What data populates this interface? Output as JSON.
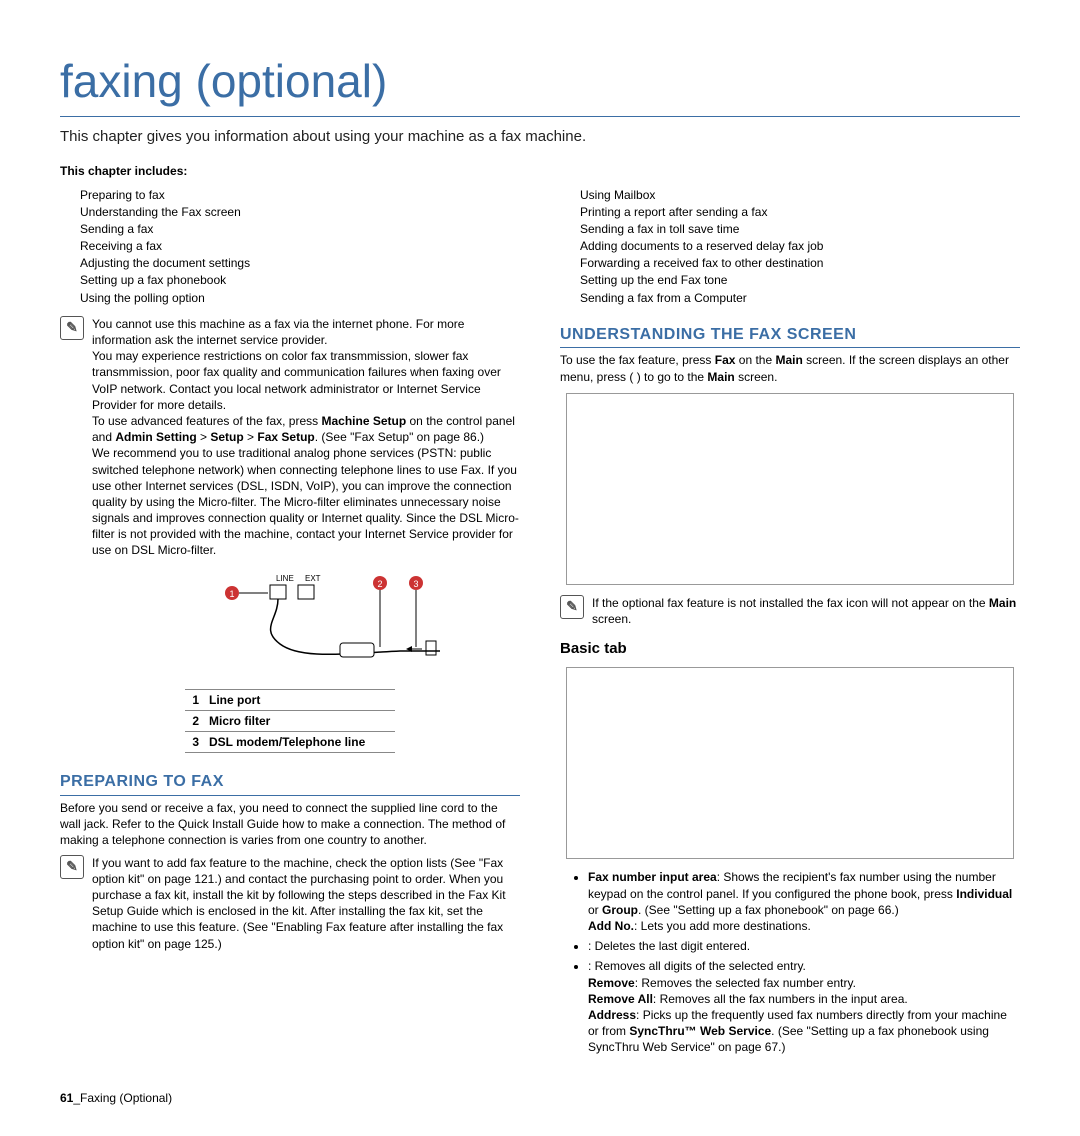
{
  "title": "faxing (optional)",
  "intro": "This chapter gives you information about using your machine as a fax machine.",
  "includes_label": "This chapter includes:",
  "toc_left": [
    "Preparing to fax",
    "Understanding the Fax screen",
    "Sending a fax",
    "Receiving a fax",
    "Adjusting the document settings",
    "Setting up a fax phonebook",
    "Using the polling option"
  ],
  "toc_right": [
    "Using Mailbox",
    "Printing a report after sending a fax",
    "Sending a fax in toll save time",
    "Adding documents to a reserved delay fax job",
    "Forwarding a received fax to other destination",
    "Setting up the end Fax tone",
    "Sending a fax from a Computer"
  ],
  "left_note": {
    "p1": "You cannot use this machine as a fax via the internet phone. For more information ask the internet service provider.",
    "p2": "You may experience restrictions on color fax transmmission, slower fax transmmission, poor fax quality and communication failures when faxing over VoIP network. Contact you local network administrator or Internet Service Provider for more details.",
    "p3_a": "To use advanced features of the fax, press ",
    "p3_b": "Machine Setup",
    "p3_c": " on the control panel and ",
    "p3_d": "Admin Setting",
    "p3_e": "Setup",
    "p3_f": "Fax Setup",
    "p3_g": ". (See \"Fax Setup\" on page 86.)",
    "p4": "We recommend you to use traditional analog phone services (PSTN: public switched telephone network) when connecting telephone lines to use Fax. If you use other Internet services (DSL, ISDN, VoIP), you can improve the connection quality by using the Micro-filter. The Micro-filter eliminates unnecessary noise signals and improves connection quality or Internet quality. Since the DSL Micro-filter is not provided with the machine, contact your Internet Service provider for use on DSL Micro-filter."
  },
  "diagram": {
    "line_label": "LINE",
    "ext_label": "EXT",
    "markers": [
      "1",
      "2",
      "3"
    ],
    "legend": [
      {
        "n": "1",
        "t": "Line port"
      },
      {
        "n": "2",
        "t": "Micro filter"
      },
      {
        "n": "3",
        "t": "DSL modem/Telephone line"
      }
    ]
  },
  "prepare": {
    "heading": "PREPARING TO FAX",
    "body": "Before you send or receive a fax, you need to connect the supplied line cord to the wall jack. Refer to the Quick Install Guide how to make a connection. The method of making a telephone connection is varies from one country to another.",
    "note": "If you want to add fax feature to the machine, check the option lists (See \"Fax option kit\" on page 121.) and contact the purchasing point to order. When you purchase a fax kit, install the kit by following the steps described in the Fax Kit Setup Guide which is enclosed in the kit. After installing the fax kit, set the machine to use this feature. (See \"Enabling Fax feature after installing the fax option kit\" on page 125.)"
  },
  "understand": {
    "heading": "UNDERSTANDING THE FAX SCREEN",
    "p1_a": "To use the fax feature, press ",
    "p1_b": "Fax",
    "p1_c": " on the ",
    "p1_d": "Main",
    "p1_e": " screen. If the screen displays an other menu, press (     ) to go to the ",
    "p1_f": "Main",
    "p1_g": " screen.",
    "note_a": "If the optional fax feature is not installed the fax icon will not appear on the ",
    "note_b": "Main",
    "note_c": " screen."
  },
  "basic": {
    "heading": "Basic tab",
    "items": {
      "fax_num_a": "Fax number input area",
      "fax_num_b": ": Shows the recipient's fax number using the number keypad on the control panel. If you configured the phone book, press ",
      "fax_num_c": "Individual",
      "fax_num_d": " or ",
      "fax_num_e": "Group",
      "fax_num_f": ". (See \"Setting up a fax phonebook\" on page 66.)",
      "addno_a": "Add No.",
      "addno_b": ": Lets you add more destinations.",
      "del": "     :   Deletes the last digit entered.",
      "clr": "     :   Removes all digits of the selected entry.",
      "remove_a": "Remove",
      "remove_b": ": Removes the selected fax number entry.",
      "removeall_a": "Remove All",
      "removeall_b": ": Removes all the fax numbers in the input area.",
      "addr_a": "Address",
      "addr_b": ": Picks up the frequently used fax numbers directly from your machine or from ",
      "addr_c": "SyncThru™ Web Service",
      "addr_d": ". (See \"Setting up a fax phonebook using SyncThru  Web Service\" on page 67.)"
    }
  },
  "footer": {
    "page": "61",
    "sep": "_",
    "label": "Faxing (Optional)"
  }
}
